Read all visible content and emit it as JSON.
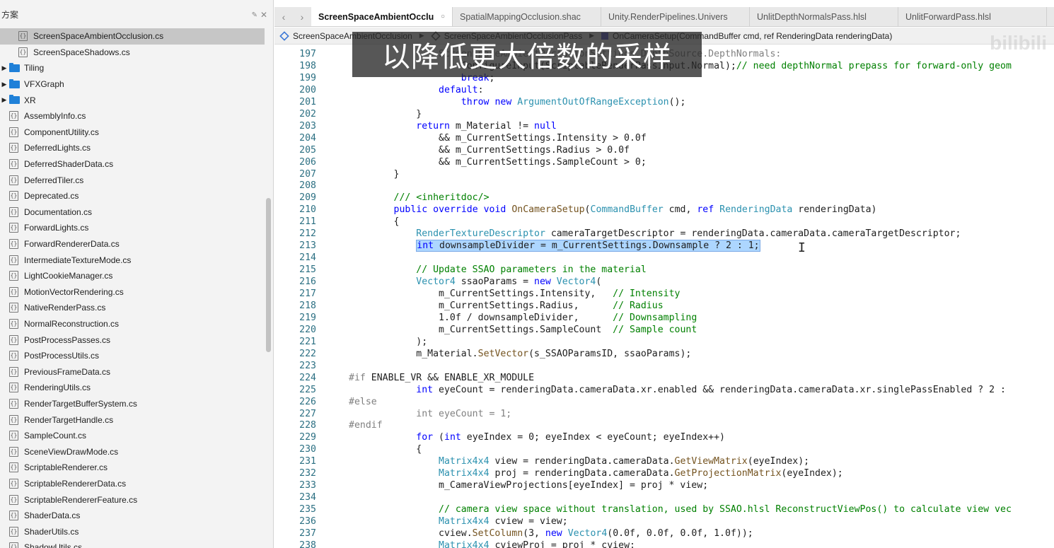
{
  "sidebar": {
    "title": "方案",
    "items": [
      {
        "label": "ScreenSpaceAmbientOcclusion.cs",
        "kind": "file",
        "indent": 2,
        "selected": true
      },
      {
        "label": "ScreenSpaceShadows.cs",
        "kind": "file",
        "indent": 2
      },
      {
        "label": "Tiling",
        "kind": "folder"
      },
      {
        "label": "VFXGraph",
        "kind": "folder"
      },
      {
        "label": "XR",
        "kind": "folder"
      },
      {
        "label": "AssemblyInfo.cs",
        "kind": "file",
        "indent": 1
      },
      {
        "label": "ComponentUtility.cs",
        "kind": "file",
        "indent": 1
      },
      {
        "label": "DeferredLights.cs",
        "kind": "file",
        "indent": 1
      },
      {
        "label": "DeferredShaderData.cs",
        "kind": "file",
        "indent": 1
      },
      {
        "label": "DeferredTiler.cs",
        "kind": "file",
        "indent": 1
      },
      {
        "label": "Deprecated.cs",
        "kind": "file",
        "indent": 1
      },
      {
        "label": "Documentation.cs",
        "kind": "file",
        "indent": 1
      },
      {
        "label": "ForwardLights.cs",
        "kind": "file",
        "indent": 1
      },
      {
        "label": "ForwardRendererData.cs",
        "kind": "file",
        "indent": 1
      },
      {
        "label": "IntermediateTextureMode.cs",
        "kind": "file",
        "indent": 1
      },
      {
        "label": "LightCookieManager.cs",
        "kind": "file",
        "indent": 1
      },
      {
        "label": "MotionVectorRendering.cs",
        "kind": "file",
        "indent": 1
      },
      {
        "label": "NativeRenderPass.cs",
        "kind": "file",
        "indent": 1
      },
      {
        "label": "NormalReconstruction.cs",
        "kind": "file",
        "indent": 1
      },
      {
        "label": "PostProcessPasses.cs",
        "kind": "file",
        "indent": 1
      },
      {
        "label": "PostProcessUtils.cs",
        "kind": "file",
        "indent": 1
      },
      {
        "label": "PreviousFrameData.cs",
        "kind": "file",
        "indent": 1
      },
      {
        "label": "RenderingUtils.cs",
        "kind": "file",
        "indent": 1
      },
      {
        "label": "RenderTargetBufferSystem.cs",
        "kind": "file",
        "indent": 1
      },
      {
        "label": "RenderTargetHandle.cs",
        "kind": "file",
        "indent": 1
      },
      {
        "label": "SampleCount.cs",
        "kind": "file",
        "indent": 1
      },
      {
        "label": "SceneViewDrawMode.cs",
        "kind": "file",
        "indent": 1
      },
      {
        "label": "ScriptableRenderer.cs",
        "kind": "file",
        "indent": 1
      },
      {
        "label": "ScriptableRendererData.cs",
        "kind": "file",
        "indent": 1
      },
      {
        "label": "ScriptableRendererFeature.cs",
        "kind": "file",
        "indent": 1
      },
      {
        "label": "ShaderData.cs",
        "kind": "file",
        "indent": 1
      },
      {
        "label": "ShaderUtils.cs",
        "kind": "file",
        "indent": 1
      },
      {
        "label": "ShadowUtils.cs",
        "kind": "file",
        "indent": 1
      }
    ]
  },
  "tabs": [
    {
      "label": "ScreenSpaceAmbientOcclu",
      "active": true
    },
    {
      "label": "SpatialMappingOcclusion.shac"
    },
    {
      "label": "Unity.RenderPipelines.Univers"
    },
    {
      "label": "UnlitDepthNormalsPass.hlsl"
    },
    {
      "label": "UnlitForwardPass.hlsl"
    }
  ],
  "breadcrumb": {
    "namespace": "ScreenSpaceAmbientOcclusion",
    "class": "ScreenSpaceAmbientOcclusionPass",
    "method": "OnCameraSetup(CommandBuffer cmd, ref RenderingData renderingData)"
  },
  "subtitle": "以降低更大倍数的采样",
  "watermark": "bilibili",
  "code_lines": [
    {
      "n": "197",
      "html": "<span class=\"dim\">                ScreenSpaceAmbientOcclusionSettings.DepthSource.DepthNormals:</span>"
    },
    {
      "n": "198",
      "html": "                    ConfigureInput(ScriptableRenderPassInput.Normal);<span class=\"cm\">// need depthNormal prepass for forward-only geom</span>"
    },
    {
      "n": "199",
      "html": "                    <span class=\"kw\">break</span>;"
    },
    {
      "n": "200",
      "html": "                <span class=\"kw\">default</span>:"
    },
    {
      "n": "201",
      "html": "                    <span class=\"kw\">throw</span> <span class=\"kw\">new</span> <span class=\"ty\">ArgumentOutOfRangeException</span>();"
    },
    {
      "n": "202",
      "html": "            }"
    },
    {
      "n": "203",
      "html": "            <span class=\"kw\">return</span> m_Material != <span class=\"kw\">null</span>"
    },
    {
      "n": "204",
      "html": "                &amp;&amp; m_CurrentSettings.Intensity &gt; 0.0f"
    },
    {
      "n": "205",
      "html": "                &amp;&amp; m_CurrentSettings.Radius &gt; 0.0f"
    },
    {
      "n": "206",
      "html": "                &amp;&amp; m_CurrentSettings.SampleCount &gt; 0;"
    },
    {
      "n": "207",
      "html": "        }"
    },
    {
      "n": "208",
      "html": ""
    },
    {
      "n": "209",
      "html": "        <span class=\"cm\">/// &lt;inheritdoc/&gt;</span>"
    },
    {
      "n": "210",
      "html": "        <span class=\"kw\">public</span> <span class=\"kw\">override</span> <span class=\"kw\">void</span> <span class=\"fn\">OnCameraSetup</span>(<span class=\"ty\">CommandBuffer</span> cmd, <span class=\"kw\">ref</span> <span class=\"ty\">RenderingData</span> renderingData)"
    },
    {
      "n": "211",
      "html": "        {"
    },
    {
      "n": "212",
      "html": "            <span class=\"ty\">RenderTextureDescriptor</span> cameraTargetDescriptor = renderingData.cameraData.cameraTargetDescriptor;"
    },
    {
      "n": "213",
      "html": "            <span class=\"sel\"><span class=\"kw\">int</span> downsampleDivider = m_CurrentSettings.Downsample ? 2 : 1;</span>"
    },
    {
      "n": "214",
      "html": ""
    },
    {
      "n": "215",
      "html": "            <span class=\"cm\">// Update SSAO parameters in the material</span>"
    },
    {
      "n": "216",
      "html": "            <span class=\"ty\">Vector4</span> ssaoParams = <span class=\"kw\">new</span> <span class=\"ty\">Vector4</span>("
    },
    {
      "n": "217",
      "html": "                m_CurrentSettings.Intensity,   <span class=\"cm\">// Intensity</span>"
    },
    {
      "n": "218",
      "html": "                m_CurrentSettings.Radius,      <span class=\"cm\">// Radius</span>"
    },
    {
      "n": "219",
      "html": "                1.0f / downsampleDivider,      <span class=\"cm\">// Downsampling</span>"
    },
    {
      "n": "220",
      "html": "                m_CurrentSettings.SampleCount  <span class=\"cm\">// Sample count</span>"
    },
    {
      "n": "221",
      "html": "            );"
    },
    {
      "n": "222",
      "html": "            m_Material.<span class=\"fn\">SetVector</span>(s_SSAOParamsID, ssaoParams);"
    },
    {
      "n": "223",
      "html": ""
    },
    {
      "n": "224",
      "html": "<span class=\"pp\">#if</span> ENABLE_VR &amp;&amp; ENABLE_XR_MODULE"
    },
    {
      "n": "225",
      "html": "            <span class=\"kw\">int</span> eyeCount = renderingData.cameraData.xr.enabled &amp;&amp; renderingData.cameraData.xr.singlePassEnabled ? 2 :"
    },
    {
      "n": "226",
      "html": "<span class=\"pp\">#else</span>"
    },
    {
      "n": "227",
      "html": "<span class=\"dim\">            int eyeCount = 1;</span>"
    },
    {
      "n": "228",
      "html": "<span class=\"pp\">#endif</span>"
    },
    {
      "n": "229",
      "html": "            <span class=\"kw\">for</span> (<span class=\"kw\">int</span> eyeIndex = 0; eyeIndex &lt; eyeCount; eyeIndex++)"
    },
    {
      "n": "230",
      "html": "            {"
    },
    {
      "n": "231",
      "html": "                <span class=\"ty\">Matrix4x4</span> view = renderingData.cameraData.<span class=\"fn\">GetViewMatrix</span>(eyeIndex);"
    },
    {
      "n": "232",
      "html": "                <span class=\"ty\">Matrix4x4</span> proj = renderingData.cameraData.<span class=\"fn\">GetProjectionMatrix</span>(eyeIndex);"
    },
    {
      "n": "233",
      "html": "                m_CameraViewProjections[eyeIndex] = proj * view;"
    },
    {
      "n": "234",
      "html": ""
    },
    {
      "n": "235",
      "html": "                <span class=\"cm\">// camera view space without translation, used by SSAO.hlsl ReconstructViewPos() to calculate view vec</span>"
    },
    {
      "n": "236",
      "html": "                <span class=\"ty\">Matrix4x4</span> cview = view;"
    },
    {
      "n": "237",
      "html": "                cview.<span class=\"fn\">SetColumn</span>(3, <span class=\"kw\">new</span> <span class=\"ty\">Vector4</span>(0.0f, 0.0f, 0.0f, 1.0f));"
    },
    {
      "n": "238",
      "html": "                <span class=\"ty\">Matrix4x4</span> cviewProj = proj * cview;"
    }
  ]
}
